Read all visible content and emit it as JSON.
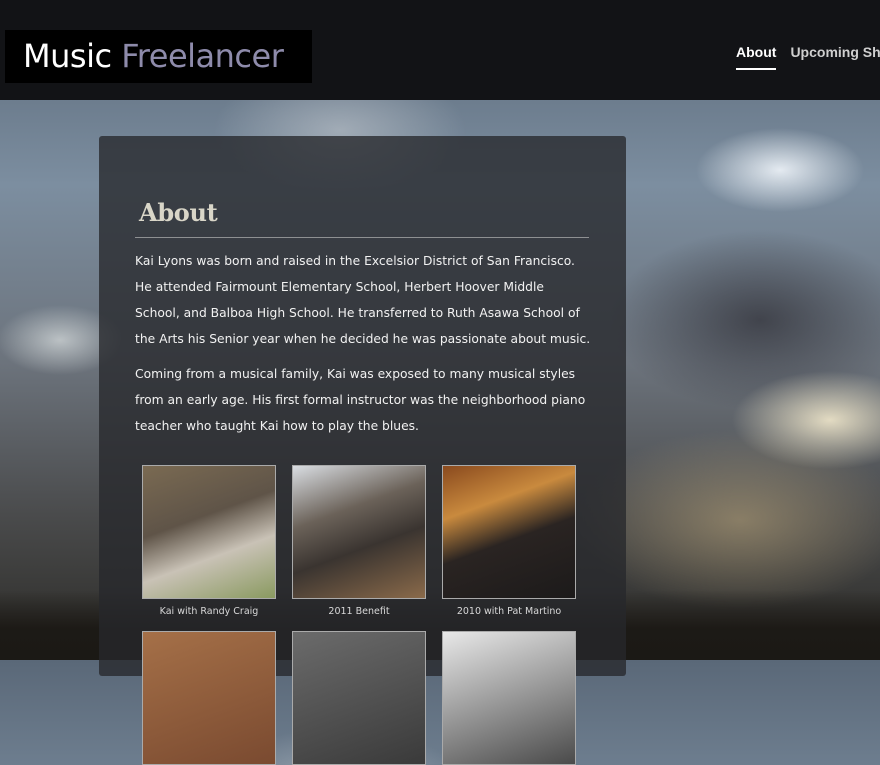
{
  "site": {
    "logo_word1": "Music",
    "logo_word2": "Freelancer"
  },
  "nav": {
    "items": [
      {
        "label": "About",
        "active": true
      },
      {
        "label": "Upcoming Sh",
        "active": false
      }
    ]
  },
  "about": {
    "heading": "About",
    "paragraphs": [
      "Kai Lyons was born and raised in the Excelsior District of San Francisco. He attended Fairmount Elementary School, Herbert Hoover Middle School, and Balboa High School. He transferred to Ruth Asawa School of the Arts his Senior year when he decided he was passionate about music.",
      "Coming from a musical family, Kai was exposed to many musical styles from an early age. His first formal instructor was the neighborhood piano teacher who taught Kai how to play the blues."
    ]
  },
  "gallery": {
    "photos": [
      {
        "caption": "Kai with Randy Craig"
      },
      {
        "caption": "2011 Benefit"
      },
      {
        "caption": "2010 with Pat Martino"
      },
      {
        "caption": ""
      },
      {
        "caption": ""
      },
      {
        "caption": ""
      }
    ]
  },
  "colors": {
    "topbar": "#121316",
    "logo_accent": "#8e8bab",
    "heading": "#d9d6c8"
  }
}
